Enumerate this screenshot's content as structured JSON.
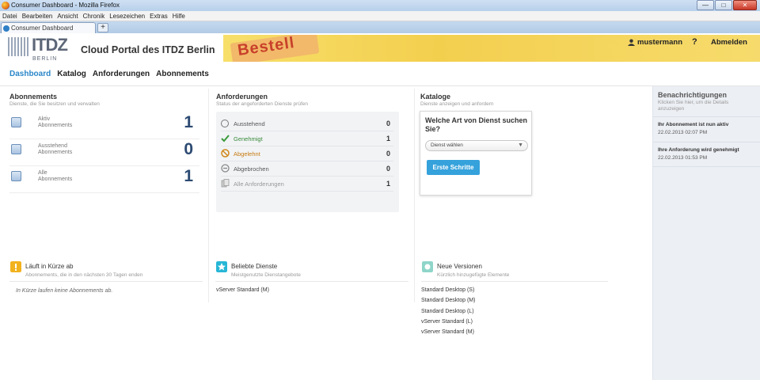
{
  "browser": {
    "window_title": "Consumer Dashboard - Mozilla Firefox",
    "menu": [
      "Datei",
      "Bearbeiten",
      "Ansicht",
      "Chronik",
      "Lesezeichen",
      "Extras",
      "Hilfe"
    ],
    "tab_title": "Consumer Dashboard",
    "new_tab": "+",
    "controls": {
      "minimize": "—",
      "maximize": "□",
      "close": "✕"
    }
  },
  "header": {
    "logo_main": "ITDZ",
    "logo_sub": "BERLIN",
    "portal_title": "Cloud Portal des ITDZ Berlin",
    "banner_text": "Bestell",
    "username": "mustermann",
    "help": "?",
    "logout": "Abmelden"
  },
  "nav": {
    "items": [
      "Dashboard",
      "Katalog",
      "Anforderungen",
      "Abonnements"
    ],
    "active": "Dashboard"
  },
  "abonnements": {
    "title": "Abonnements",
    "subtitle": "Dienste, die Sie besitzen und verwalten",
    "rows": [
      {
        "label": "Aktiv",
        "sub": "Abonnements",
        "count": "1"
      },
      {
        "label": "Ausstehend",
        "sub": "Abonnements",
        "count": "0"
      },
      {
        "label": "Alle",
        "sub": "Abonnements",
        "count": "1"
      }
    ]
  },
  "anforderungen": {
    "title": "Anforderungen",
    "subtitle": "Status der angeforderten Dienste prüfen",
    "rows": [
      {
        "label": "Ausstehend",
        "value": "0",
        "color": "#555555"
      },
      {
        "label": "Genehmigt",
        "value": "1",
        "color": "#3a8a3a"
      },
      {
        "label": "Abgelehnt",
        "value": "0",
        "color": "#c87a10"
      },
      {
        "label": "Abgebrochen",
        "value": "0",
        "color": "#777777"
      },
      {
        "label": "Alle Anforderungen",
        "value": "1",
        "color": "#8a8a8a"
      }
    ]
  },
  "kataloge": {
    "title": "Kataloge",
    "subtitle": "Dienste anzeigen und anfordern",
    "question": "Welche Art von Dienst suchen Sie?",
    "select_value": "Dienst wählen",
    "button": "Erste Schritte"
  },
  "benachrichtigungen": {
    "title": "Benachrichtigungen",
    "subtitle": "Klicken Sie hier, um die Details anzuzeigen",
    "items": [
      {
        "text": "Ihr Abonnement ist nun aktiv",
        "date": "22.02.2013 02:07 PM"
      },
      {
        "text": "Ihre Anforderung wird genehmigt",
        "date": "22.02.2013 01:53 PM"
      }
    ]
  },
  "expiring": {
    "title": "Läuft in Kürze ab",
    "subtitle": "Abonnements, die in den nächsten 30 Tagen enden",
    "empty": "In Kürze laufen keine Abonnements ab."
  },
  "popular": {
    "title": "Beliebte Dienste",
    "subtitle": "Meistgenutzte Dienstangebote",
    "items": [
      "vServer Standard (M)"
    ]
  },
  "new_versions": {
    "title": "Neue Versionen",
    "subtitle": "Kürzlich hinzugefügte Elemente",
    "items": [
      "Standard Desktop (S)",
      "Standard Desktop (M)",
      "Standard Desktop (L)",
      "vServer Standard (L)",
      "vServer Standard (M)"
    ]
  },
  "colors": {
    "accent": "#2b87c8",
    "button": "#35a2dc",
    "count": "#2c4a72",
    "banner": "#f3cf4e"
  }
}
